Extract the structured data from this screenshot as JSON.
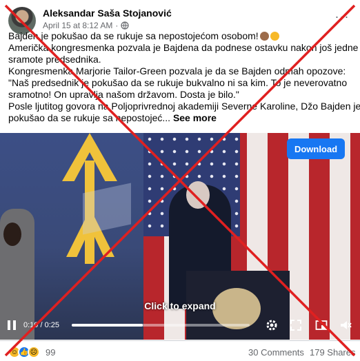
{
  "post": {
    "author": "Aleksandar Saša Stojanović",
    "timestamp": "April 15 at 8:12 AM",
    "dot": "·",
    "more_label": "···",
    "lines": [
      "Bajden je pokušao da se rukuje sa nepostojećom osobom!",
      "Američka kongresmenka pozvala je Bajdena da podnese ostavku nakon još jedne",
      "sramote predsednika.",
      "Kongresmenka Marjorie Tailor-Green pozvala je da se Bajden odmah opozove:",
      "\"Naš predsednik je pokušao da se rukuje bukvalno ni sa kim. To je neverovatno",
      "sramotno! On upravlja našom državom. Dosta je bilo.\"",
      "Posle ljutitog govora na Poljoprivrednoj akademiji Severne Karoline, Džo Bajden je"
    ],
    "last_line": "pokušao da se rukuje sa nepostojeć...",
    "see_more": "See more"
  },
  "video": {
    "download_label": "Download",
    "expand_label": "Click to expand",
    "time": "0:10 / 0:25",
    "progress": 0.4
  },
  "footer": {
    "reaction_count": "99",
    "comments": "30 Comments",
    "shares": "179 Shares"
  },
  "icons": [
    "globe-icon",
    "play-icon",
    "gear-icon",
    "fullscreen-icon",
    "pip-icon",
    "volume-icon"
  ],
  "colors": {
    "accent": "#1877f2",
    "cross": "#e02020",
    "text_secondary": "#65676b"
  }
}
